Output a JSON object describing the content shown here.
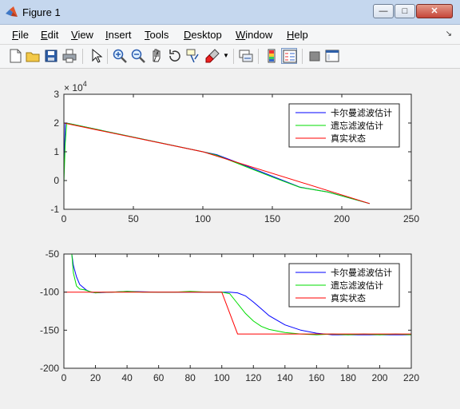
{
  "window": {
    "title": "Figure 1"
  },
  "menu": {
    "items": [
      {
        "label": "File",
        "accel": "F",
        "rest": "ile"
      },
      {
        "label": "Edit",
        "accel": "E",
        "rest": "dit"
      },
      {
        "label": "View",
        "accel": "V",
        "rest": "iew"
      },
      {
        "label": "Insert",
        "accel": "I",
        "rest": "nsert"
      },
      {
        "label": "Tools",
        "accel": "T",
        "rest": "ools"
      },
      {
        "label": "Desktop",
        "accel": "D",
        "rest": "esktop"
      },
      {
        "label": "Window",
        "accel": "W",
        "rest": "indow"
      },
      {
        "label": "Help",
        "accel": "H",
        "rest": "elp"
      }
    ]
  },
  "toolbar": {
    "icons": [
      "new-figure-icon",
      "open-file-icon",
      "save-icon",
      "print-icon",
      "pointer-icon",
      "zoom-in-icon",
      "zoom-out-icon",
      "pan-icon",
      "rotate-3d-icon",
      "data-cursor-icon",
      "brush-icon",
      "link-plot-icon",
      "colorbar-icon",
      "legend-icon",
      "hide-tools-icon",
      "show-tools-icon"
    ]
  },
  "chart_data": [
    {
      "type": "line",
      "xlim": [
        0,
        250
      ],
      "ylim": [
        -10000,
        30000
      ],
      "xticks": [
        0,
        50,
        100,
        150,
        200,
        250
      ],
      "yticks": [
        -10000,
        0,
        10000,
        20000,
        30000
      ],
      "yticklabels": [
        "-1",
        "0",
        "1",
        "2",
        "3"
      ],
      "yexponent_base": "× 10",
      "yexponent_power": "4",
      "legend": "top-right",
      "series": [
        {
          "name": "卡尔曼滤波估计",
          "color": "#0000ff",
          "x": [
            0,
            1,
            2,
            3,
            100,
            110,
            130,
            150,
            170,
            190,
            220
          ],
          "y": [
            2000,
            20000,
            20000,
            19900,
            10000,
            9000,
            5300,
            1500,
            -2300,
            -4000,
            -8000
          ]
        },
        {
          "name": "遗忘滤波估计",
          "color": "#00dd00",
          "x": [
            0,
            1,
            2,
            3,
            100,
            110,
            130,
            150,
            170,
            190,
            220
          ],
          "y": [
            -1000,
            13000,
            19800,
            19900,
            10000,
            8800,
            5000,
            1200,
            -2400,
            -4000,
            -8000
          ]
        },
        {
          "name": "真实状态",
          "color": "#ff0000",
          "x": [
            0,
            100,
            220
          ],
          "y": [
            20000,
            10000,
            -8000
          ]
        }
      ]
    },
    {
      "type": "line",
      "xlim": [
        0,
        220
      ],
      "ylim": [
        -200,
        -50
      ],
      "xticks": [
        0,
        20,
        40,
        60,
        80,
        100,
        120,
        140,
        160,
        180,
        200,
        220
      ],
      "yticks": [
        -200,
        -150,
        -100,
        -50
      ],
      "legend": "top-right",
      "series": [
        {
          "name": "卡尔曼滤波估计",
          "color": "#0000ff",
          "x": [
            5,
            6,
            8,
            10,
            14,
            17,
            20,
            30,
            40,
            60,
            80,
            100,
            105,
            110,
            115,
            120,
            125,
            130,
            140,
            150,
            160,
            170,
            180,
            190,
            200,
            210,
            220
          ],
          "y": [
            -50,
            -65,
            -80,
            -90,
            -97,
            -100,
            -101,
            -100,
            -99,
            -100,
            -100,
            -100,
            -100,
            -101,
            -105,
            -113,
            -122,
            -131,
            -143,
            -150,
            -154,
            -156,
            -156,
            -156,
            -156,
            -156,
            -156
          ]
        },
        {
          "name": "遗忘滤波估计",
          "color": "#00dd00",
          "x": [
            5,
            6,
            8,
            10,
            13,
            16,
            20,
            25,
            30,
            40,
            50,
            60,
            70,
            80,
            90,
            100,
            105,
            110,
            115,
            120,
            125,
            130,
            140,
            150,
            160,
            170,
            180,
            190,
            200,
            210,
            220
          ],
          "y": [
            -50,
            -75,
            -92,
            -96,
            -97,
            -99,
            -101,
            -100,
            -100,
            -99,
            -100,
            -100,
            -100,
            -99,
            -100,
            -100,
            -102,
            -115,
            -128,
            -138,
            -145,
            -149,
            -153,
            -155,
            -156,
            -155,
            -156,
            -155,
            -156,
            -155,
            -156
          ]
        },
        {
          "name": "真实状态",
          "color": "#ff0000",
          "x": [
            0,
            100,
            110,
            220
          ],
          "y": [
            -100,
            -100,
            -155,
            -155
          ]
        }
      ]
    }
  ]
}
